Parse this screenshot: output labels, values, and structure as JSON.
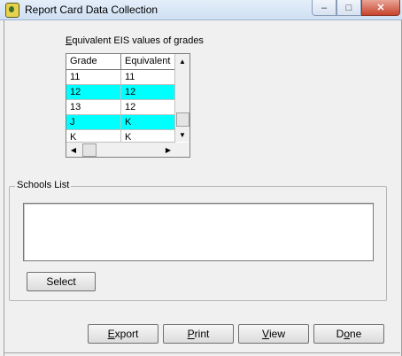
{
  "window": {
    "title": "Report Card Data Collection",
    "minimize_glyph": "–",
    "maximize_glyph": "□",
    "close_glyph": "✕"
  },
  "grades_section": {
    "label_accesskey": "E",
    "label_rest": "quivalent EIS values of grades",
    "columns": [
      "Grade",
      "Equivalent"
    ],
    "rows": [
      {
        "grade": "11",
        "equivalent": "11",
        "highlighted": false
      },
      {
        "grade": "12",
        "equivalent": "12",
        "highlighted": true
      },
      {
        "grade": "13",
        "equivalent": "12",
        "highlighted": false
      },
      {
        "grade": "J",
        "equivalent": "K",
        "highlighted": true
      },
      {
        "grade": "K",
        "equivalent": "K",
        "highlighted": false
      }
    ],
    "highlight_color": "#00ffff"
  },
  "schools": {
    "group_label": "Schools List",
    "select_label": "Select"
  },
  "buttons": {
    "export_accesskey": "E",
    "export_rest": "xport",
    "print_accesskey": "P",
    "print_rest": "rint",
    "view_accesskey": "V",
    "view_rest": "iew",
    "done_prefix": "D",
    "done_accesskey": "o",
    "done_rest": "ne"
  },
  "icons": {
    "app": "app-icon",
    "scroll_up": "▲",
    "scroll_down": "▼",
    "scroll_left": "◀",
    "scroll_right": "▶"
  }
}
